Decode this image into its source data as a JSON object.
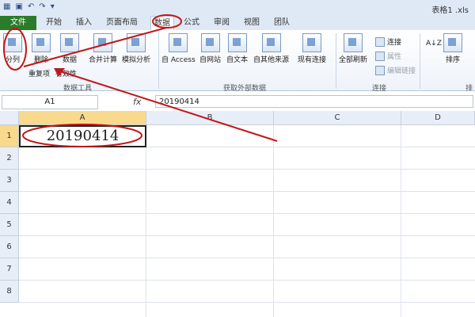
{
  "window": {
    "title": "表格1 .xls"
  },
  "tabs": [
    {
      "label": "文件"
    },
    {
      "label": "开始"
    },
    {
      "label": "插入"
    },
    {
      "label": "页面布局"
    },
    {
      "label": "数据"
    },
    {
      "label": "公式"
    },
    {
      "label": "审阅"
    },
    {
      "label": "视图"
    },
    {
      "label": "团队"
    }
  ],
  "ribbon": {
    "split": "分列",
    "remove_dup": "删除",
    "remove_dup2": "重复项",
    "data_valid": "数据",
    "data_valid2": "有效性",
    "merge_calc": "合并计算",
    "what_if": "模拟分析",
    "from_access": "自 Access",
    "from_web": "自网站",
    "from_text": "自文本",
    "from_other": "自其他来源",
    "existing_conn": "现有连接",
    "refresh_all": "全部刷新",
    "connections": "连接",
    "properties": "属性",
    "edit_links": "编辑链接",
    "sort": "排序",
    "group_data_tools": "数据工具",
    "group_get_external": "获取外部数据",
    "group_connections": "连接",
    "group_sort_partial": "排"
  },
  "formula_bar": {
    "name_box": "A1",
    "fx": "fx",
    "value": "20190414"
  },
  "columns": [
    "A",
    "B",
    "C",
    "D"
  ],
  "rows": [
    "1",
    "2",
    "3",
    "4",
    "5",
    "6",
    "7",
    "8"
  ],
  "cells": {
    "A1": "20190414"
  },
  "colors": {
    "file_tab": "#2a7c2a",
    "selection_header": "#f9d98c",
    "annotation": "#c0181a"
  }
}
